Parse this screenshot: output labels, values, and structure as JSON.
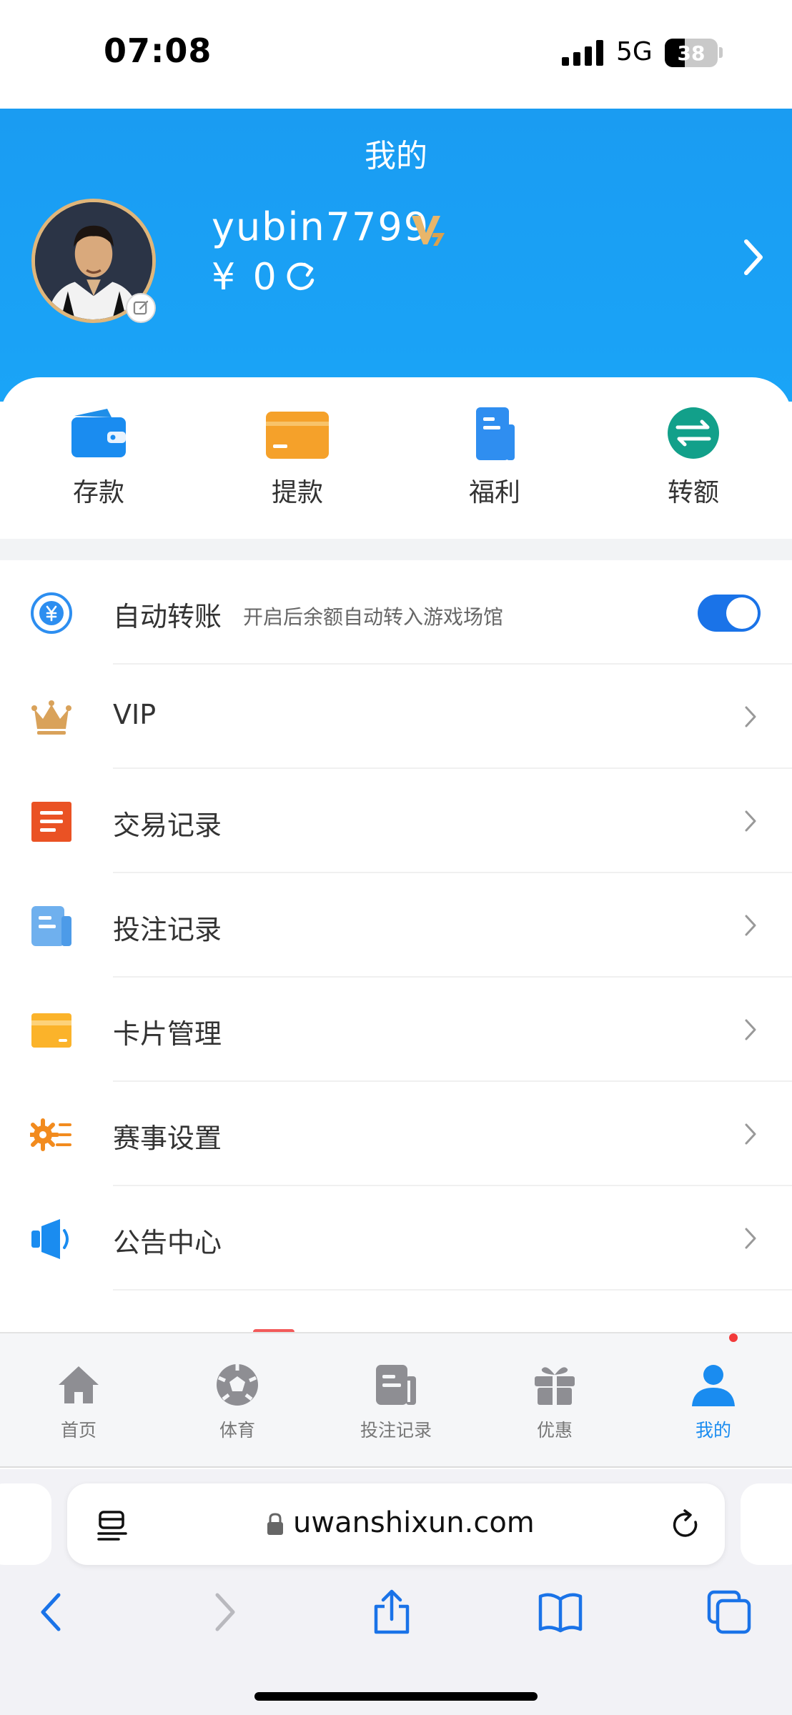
{
  "status_bar": {
    "time": "07:08",
    "network": "5G",
    "battery": "38",
    "battery_level": 0.38
  },
  "header": {
    "title": "我的",
    "username": "yubin7799",
    "balance": "¥ 0",
    "vip_badge_text": "V7"
  },
  "quick_actions": [
    {
      "label": "存款",
      "icon": "wallet-icon"
    },
    {
      "label": "提款",
      "icon": "card-icon"
    },
    {
      "label": "福利",
      "icon": "document-icon"
    },
    {
      "label": "转额",
      "icon": "transfer-icon"
    }
  ],
  "menu": {
    "auto_transfer": {
      "label": "自动转账",
      "description": "开启后余额自动转入游戏场馆",
      "enabled": true
    },
    "items": [
      {
        "label": "VIP",
        "icon": "crown-icon"
      },
      {
        "label": "交易记录",
        "icon": "transaction-list-icon"
      },
      {
        "label": "投注记录",
        "icon": "bet-record-icon"
      },
      {
        "label": "卡片管理",
        "icon": "bank-card-icon"
      },
      {
        "label": "赛事设置",
        "icon": "settings-gear-icon"
      },
      {
        "label": "公告中心",
        "icon": "announcement-icon"
      }
    ]
  },
  "tabbar": {
    "tabs": [
      {
        "label": "首页",
        "icon": "home-icon"
      },
      {
        "label": "体育",
        "icon": "soccer-ball-icon"
      },
      {
        "label": "投注记录",
        "icon": "bet-slip-icon"
      },
      {
        "label": "优惠",
        "icon": "gift-icon"
      },
      {
        "label": "我的",
        "icon": "user-icon"
      }
    ],
    "active": "我的"
  },
  "browser": {
    "url": "uwanshixun.com"
  },
  "colors": {
    "header_blue": "#1a9cf2",
    "active_tab": "#1a8cf0",
    "toggle_on": "#1a73e8"
  }
}
